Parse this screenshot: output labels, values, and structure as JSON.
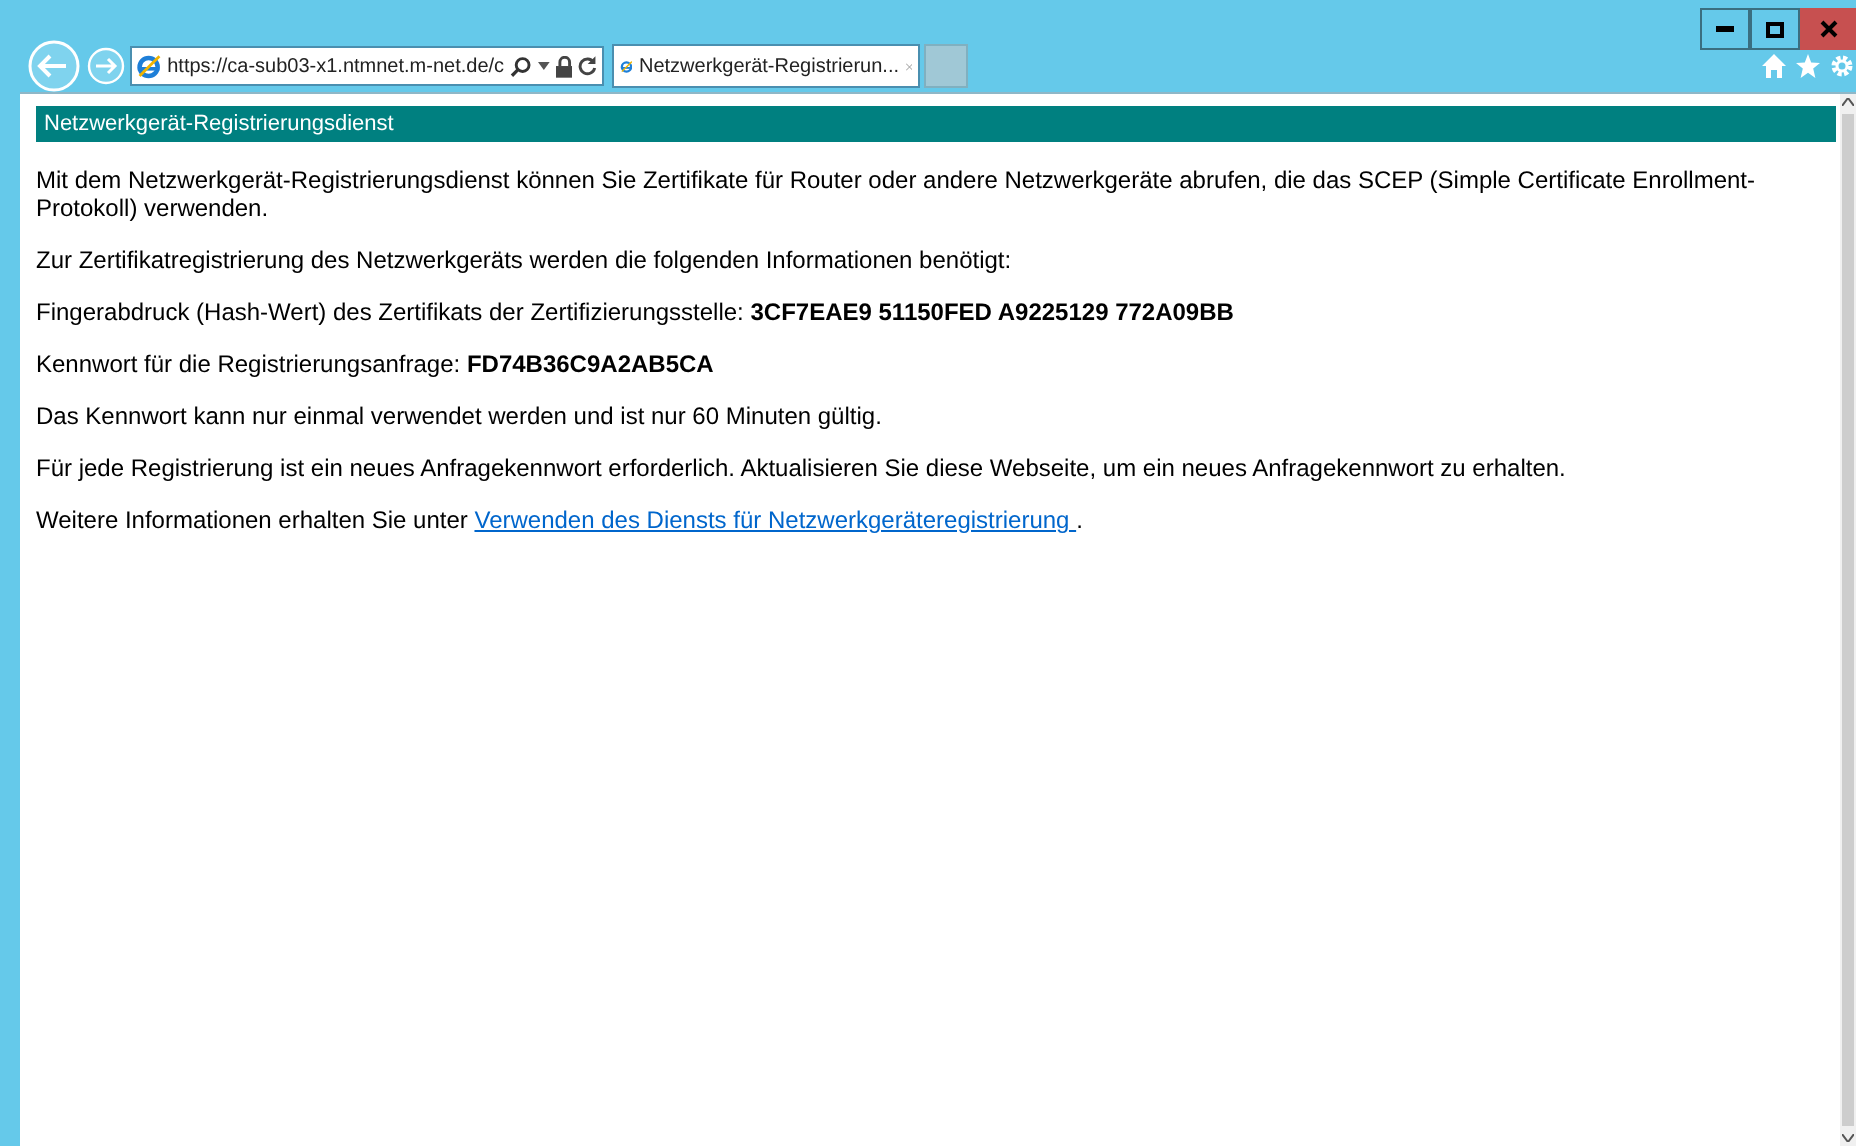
{
  "browser": {
    "address": "https://ca-sub03-x1.ntmnet.m-net.de/c",
    "tabs": [
      {
        "title": "Netzwerkgerät-Registrierun...",
        "selected": true
      }
    ]
  },
  "page": {
    "header": "Netzwerkgerät-Registrierungsdienst",
    "paragraphs": [
      "Mit dem Netzwerkgerät-Registrierungsdienst können Sie Zertifikate für Router oder andere Netzwerkgeräte abrufen, die das SCEP (Simple Certificate Enrollment-Protokoll) verwenden.",
      "Zur Zertifikatregistrierung des Netzwerkgeräts werden die folgenden Informationen benötigt:",
      "Fingerabdruck (Hash-Wert) des Zertifikats der Zertifizierungsstelle: **3CF7EAE9 51150FED A9225129 772A09BB**",
      "Kennwort für die Registrierungsanfrage: **FD74B36C9A2AB5CA**",
      "Das Kennwort kann nur einmal verwendet werden und ist nur 60 Minuten gültig.",
      "Für jede Registrierung ist ein neues Anfragekennwort erforderlich. Aktualisieren Sie diese Webseite, um ein neues Anfragekennwort zu erhalten."
    ],
    "more_info": {
      "text": "Weitere Informationen erhalten Sie unter ",
      "link": "Verwenden des Diensts für Netzwerkgeräteregistrierung ",
      "end": "."
    }
  }
}
